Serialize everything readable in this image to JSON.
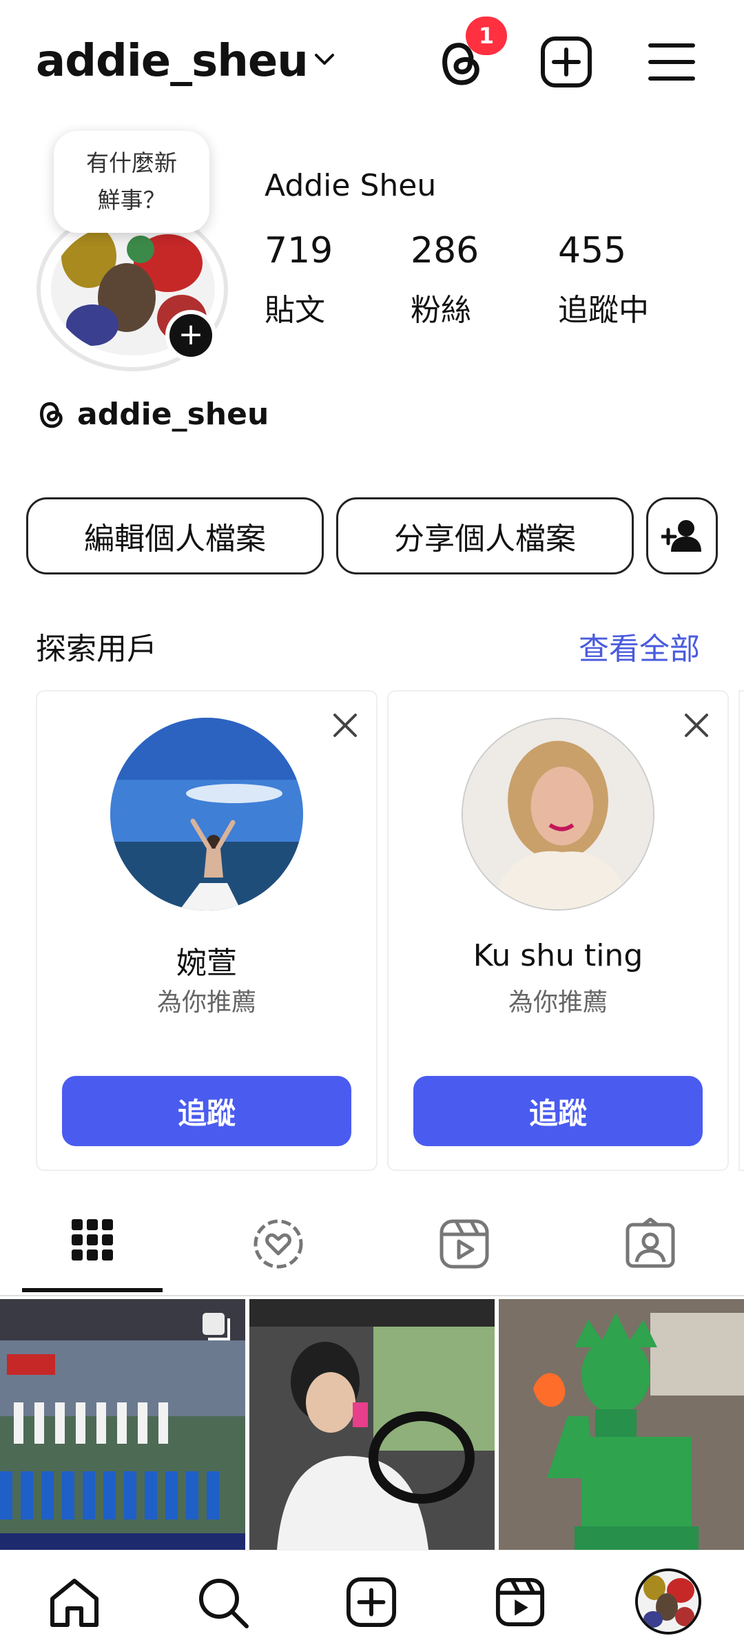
{
  "header": {
    "username": "addie_sheu",
    "threads_badge_count": "1"
  },
  "profile": {
    "note_line1": "有什麼新",
    "note_line2": "鮮事？",
    "display_name": "Addie Sheu",
    "stats": [
      {
        "value": "719",
        "label": "貼文"
      },
      {
        "value": "286",
        "label": "粉絲"
      },
      {
        "value": "455",
        "label": "追蹤中"
      }
    ],
    "threads_handle": "addie_sheu"
  },
  "actions": {
    "edit_profile": "編輯個人檔案",
    "share_profile": "分享個人檔案"
  },
  "discover": {
    "title": "探索用戶",
    "see_all": "查看全部",
    "cards": [
      {
        "name": "婉萱",
        "subtitle": "為你推薦",
        "follow": "追蹤"
      },
      {
        "name": "Ku shu ting",
        "subtitle": "為你推薦",
        "follow": "追蹤"
      }
    ]
  },
  "tabs": [
    "grid-icon",
    "activity-heart-icon",
    "reels-icon",
    "tagged-icon"
  ],
  "colors": {
    "accent": "#4a5bf0",
    "link": "#4a5bdc",
    "badge": "#ff3040"
  }
}
